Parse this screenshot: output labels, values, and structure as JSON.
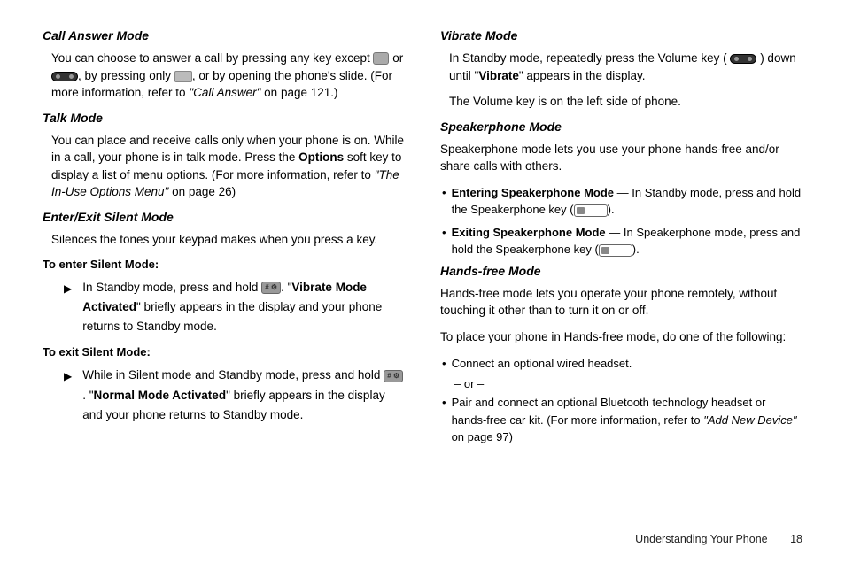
{
  "left": {
    "h_call_answer": "Call Answer Mode",
    "call_answer_p1_a": "You can choose to answer a call by pressing any key except ",
    "call_answer_p1_b": " or ",
    "call_answer_p1_c": ", by pressing only ",
    "call_answer_p1_d": ", or by opening the phone's slide. (For more information, refer to ",
    "call_answer_ref": "\"Call Answer\"",
    "call_answer_p1_e": "  on page 121.)",
    "h_talk": "Talk Mode",
    "talk_p1_a": "You can place and receive calls only when your phone is on. While in a call, your phone is in talk mode. Press the ",
    "talk_options": "Options",
    "talk_p1_b": " soft key to display a list of menu options. (For more information, refer to ",
    "talk_ref": "\"The In-Use Options Menu\"",
    "talk_p1_c": "  on page 26)",
    "h_silent": "Enter/Exit Silent Mode",
    "silent_p1": "Silences the tones your keypad makes when you press a key.",
    "h_enter_silent": "To enter Silent Mode:",
    "enter_a": "In Standby mode, press and hold ",
    "enter_b": ". \"",
    "enter_bold": "Vibrate Mode Activated",
    "enter_c": "\" briefly appears in the display and your phone returns to Standby mode.",
    "h_exit_silent": "To exit Silent Mode:",
    "exit_a": "While in Silent mode and Standby mode, press and hold ",
    "exit_b": ". \"",
    "exit_bold": "Normal Mode Activated",
    "exit_c": "\" briefly appears in the display and your phone returns to Standby mode."
  },
  "right": {
    "h_vibrate": "Vibrate Mode",
    "vibrate_p1_a": "In Standby mode, repeatedly press the Volume key ( ",
    "vibrate_p1_b": " ) down until \"",
    "vibrate_bold": "Vibrate",
    "vibrate_p1_c": "\" appears in the display.",
    "vibrate_p2": "The Volume key is on the left side of phone.",
    "h_speaker": "Speakerphone Mode",
    "speaker_p1": "Speakerphone mode lets you use your phone hands-free and/or share calls with others.",
    "speaker_b1_bold": "Entering Speakerphone Mode",
    "speaker_b1_a": " — In Standby mode, press and hold the Speakerphone key (",
    "speaker_b1_b": ").",
    "speaker_b2_bold": "Exiting Speakerphone Mode",
    "speaker_b2_a": " — In Speakerphone mode, press and hold the Speakerphone key (",
    "speaker_b2_b": ").",
    "h_hands": "Hands-free Mode",
    "hands_p1": "Hands-free mode lets you operate your phone remotely, without touching it other than to turn it on or off.",
    "hands_p2": "To place your phone in Hands-free mode, do one of the following:",
    "hands_b1": "Connect an optional wired headset.",
    "hands_or": "– or –",
    "hands_b2_a": "Pair and connect an optional Bluetooth technology headset or hands-free car kit. (For more information, refer to ",
    "hands_b2_ref": "\"Add New Device\"",
    "hands_b2_b": "  on page 97)"
  },
  "footer": {
    "section": "Understanding Your Phone",
    "page": "18"
  }
}
